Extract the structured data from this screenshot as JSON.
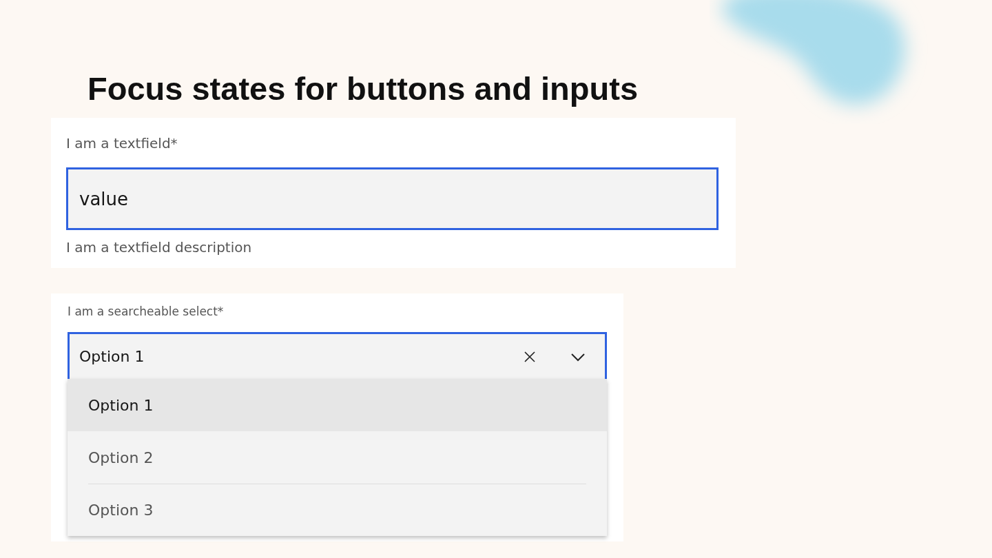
{
  "title": "Focus states for buttons and inputs",
  "textfield": {
    "label": "I am a textfield*",
    "value": "value",
    "focused": true,
    "description": "I am a textfield description"
  },
  "select": {
    "label": "I am a searcheable select*",
    "value": "Option 1",
    "focused": true,
    "expanded": true,
    "options": [
      {
        "label": "Option 1",
        "selected": true
      },
      {
        "label": "Option 2",
        "selected": false
      },
      {
        "label": "Option 3",
        "selected": false
      }
    ]
  }
}
